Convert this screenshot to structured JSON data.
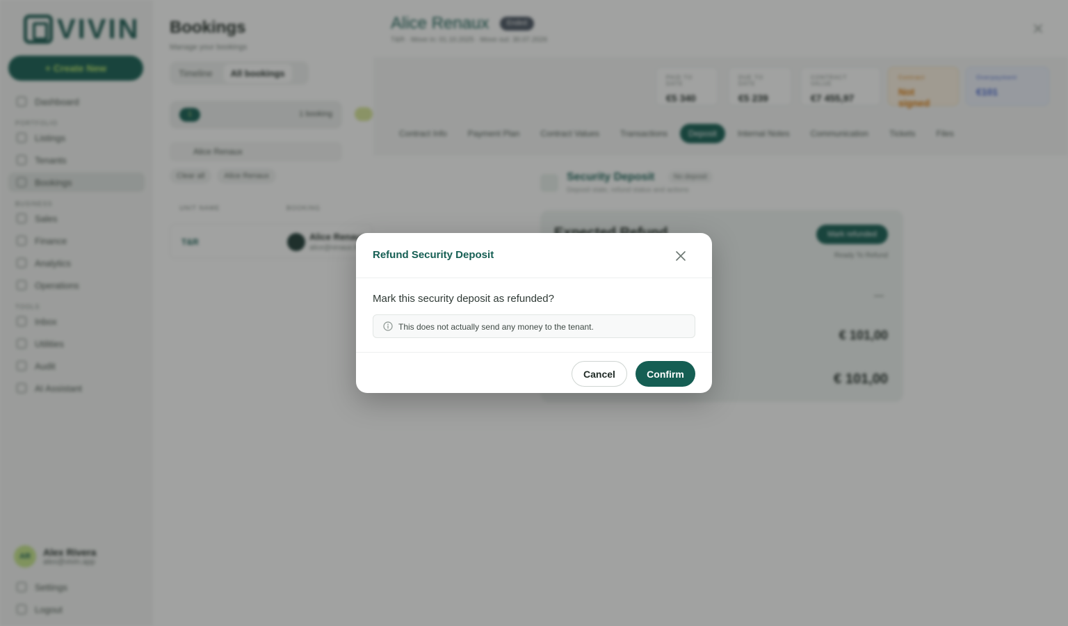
{
  "app": {
    "logo_text": "VIVIN",
    "create_label": "+ Create New",
    "nav": [
      {
        "section": "",
        "items": [
          {
            "label": "Dashboard"
          }
        ]
      },
      {
        "section": "Portfolio",
        "items": [
          {
            "label": "Listings"
          },
          {
            "label": "Tenants"
          },
          {
            "label": "Bookings"
          }
        ]
      },
      {
        "section": "Business",
        "items": [
          {
            "label": "Sales"
          },
          {
            "label": "Finance"
          },
          {
            "label": "Analytics"
          },
          {
            "label": "Operations"
          }
        ]
      },
      {
        "section": "Tools",
        "items": [
          {
            "label": "Inbox"
          },
          {
            "label": "Utilities"
          },
          {
            "label": "Audit"
          },
          {
            "label": "AI Assistant"
          }
        ]
      }
    ],
    "user": {
      "initials": "AR",
      "name": "Alex Rivera",
      "email": "alex@vivin.app"
    },
    "bottom": [
      {
        "label": "Settings"
      },
      {
        "label": "Logout"
      }
    ]
  },
  "bookings": {
    "title": "Bookings",
    "subtitle": "Manage your bookings",
    "tabs": [
      "Timeline",
      "All bookings"
    ],
    "summary": {
      "count": "1",
      "label": "1 booking"
    },
    "search_value": "Alice Renaux",
    "chips": [
      "Clear all",
      "Alice Renaux"
    ],
    "columns": [
      "UNIT NAME",
      "BOOKING"
    ],
    "row": {
      "unit": "T&R",
      "name": "Alice Renaux",
      "email": "alice@renaux.fr"
    }
  },
  "panel": {
    "title": "Alice Renaux",
    "badge": "Ended",
    "meta": "T&R · Move in: 01.10.2025 · Move out: 30.07.2026",
    "stats": [
      {
        "label": "PAID TO DATE",
        "value": "€5 340",
        "kind": "normal"
      },
      {
        "label": "DUE TO DATE",
        "value": "€5 239",
        "kind": "normal"
      },
      {
        "label": "CONTRACT VALUE",
        "value": "€7 455,97",
        "kind": "normal"
      },
      {
        "label": "Contract",
        "value": "Not signed",
        "kind": "warn"
      },
      {
        "label": "Overpayment",
        "value": "€101",
        "kind": "info"
      }
    ],
    "tabs": [
      "Contract Info",
      "Payment Plan",
      "Contract Values",
      "Transactions",
      "Deposit",
      "Internal Notes",
      "Communication",
      "Tickets",
      "Files"
    ],
    "active_tab": "Deposit",
    "deposit": {
      "title": "Security Deposit",
      "chip": "No deposit",
      "subtitle": "Deposit state, refund status and actions",
      "card_title": "Expected Refund",
      "mark_refunded": "Mark refunded",
      "ready_toggle": "Ready To Refund",
      "dash": "—",
      "amount_1": "€ 101,00",
      "amount_2": "€ 101,00"
    }
  },
  "modal": {
    "title": "Refund Security Deposit",
    "question": "Mark this security deposit as refunded?",
    "notice": "This does not actually send any money to the tenant.",
    "cancel_label": "Cancel",
    "confirm_label": "Confirm"
  },
  "colors": {
    "brand": "#155e53",
    "accent": "#b5e36a",
    "warn": "#d97706",
    "info": "#3b5ccc",
    "overlay": "rgba(30,34,32,0.42)"
  },
  "icons": {
    "modal_close": "close-icon",
    "notice": "info-circle-icon"
  }
}
